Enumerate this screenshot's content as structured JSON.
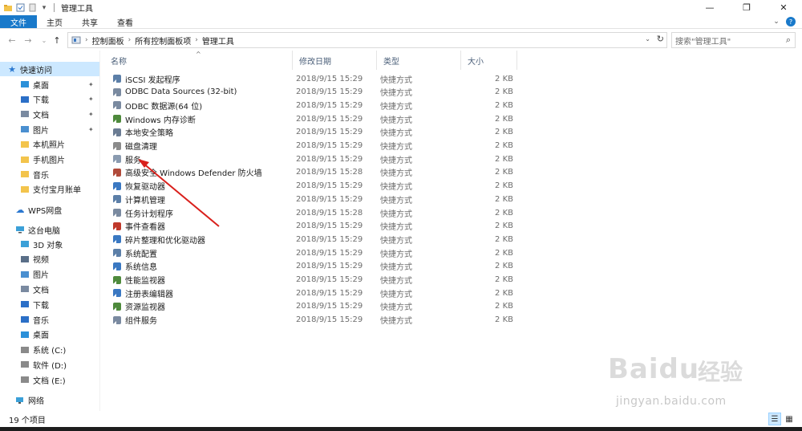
{
  "window": {
    "title": "管理工具",
    "controls": {
      "minimize": "—",
      "maximize": "❐",
      "close": "✕"
    }
  },
  "ribbon": {
    "tabs": [
      "文件",
      "主页",
      "共享",
      "查看"
    ],
    "expand_icon": "chevron-down-icon",
    "help_icon": "?"
  },
  "address": {
    "breadcrumbs": [
      "控制面板",
      "所有控制面板项",
      "管理工具"
    ],
    "search_placeholder": "搜索\"管理工具\""
  },
  "nav_pane": {
    "quick_access": "快速访问",
    "quick_items": [
      {
        "label": "桌面",
        "pinned": true,
        "icon": "desktop-icon",
        "color": "#2b90d9"
      },
      {
        "label": "下载",
        "pinned": true,
        "icon": "download-icon",
        "color": "#2b6fc7"
      },
      {
        "label": "文档",
        "pinned": true,
        "icon": "documents-icon",
        "color": "#7a8aa0"
      },
      {
        "label": "图片",
        "pinned": true,
        "icon": "pictures-icon",
        "color": "#4a8fd0"
      },
      {
        "label": "本机照片",
        "pinned": false,
        "icon": "folder-icon",
        "color": "#f3c44c"
      },
      {
        "label": "手机图片",
        "pinned": false,
        "icon": "folder-icon",
        "color": "#f3c44c"
      },
      {
        "label": "音乐",
        "pinned": false,
        "icon": "folder-icon",
        "color": "#f3c44c"
      },
      {
        "label": "支付宝月账单",
        "pinned": false,
        "icon": "folder-icon",
        "color": "#f3c44c"
      }
    ],
    "wps": "WPS网盘",
    "this_pc": "这台电脑",
    "pc_items": [
      {
        "label": "3D 对象",
        "icon": "3d-objects-icon",
        "color": "#3ba0d8"
      },
      {
        "label": "视频",
        "icon": "videos-icon",
        "color": "#5a6f88"
      },
      {
        "label": "图片",
        "icon": "pictures-icon",
        "color": "#4a8fd0"
      },
      {
        "label": "文档",
        "icon": "documents-icon",
        "color": "#7a8aa0"
      },
      {
        "label": "下载",
        "icon": "download-icon",
        "color": "#2b6fc7"
      },
      {
        "label": "音乐",
        "icon": "music-icon",
        "color": "#2b6fc7"
      },
      {
        "label": "桌面",
        "icon": "desktop-icon",
        "color": "#2b90d9"
      },
      {
        "label": "系统 (C:)",
        "icon": "drive-icon",
        "color": "#8a8a8a"
      },
      {
        "label": "软件 (D:)",
        "icon": "drive-icon",
        "color": "#8a8a8a"
      },
      {
        "label": "文档 (E:)",
        "icon": "drive-icon",
        "color": "#8a8a8a"
      }
    ],
    "network": "网络"
  },
  "columns": {
    "name": "名称",
    "date": "修改日期",
    "type": "类型",
    "size": "大小"
  },
  "files": [
    {
      "name": "iSCSI 发起程序",
      "date": "2018/9/15 15:29",
      "type": "快捷方式",
      "size": "2 KB",
      "icon": "iscsi-icon",
      "color": "#5c7fa8"
    },
    {
      "name": "ODBC Data Sources (32-bit)",
      "date": "2018/9/15 15:29",
      "type": "快捷方式",
      "size": "2 KB",
      "icon": "odbc-icon",
      "color": "#7a8aa0"
    },
    {
      "name": "ODBC 数据源(64 位)",
      "date": "2018/9/15 15:29",
      "type": "快捷方式",
      "size": "2 KB",
      "icon": "odbc-icon",
      "color": "#7a8aa0"
    },
    {
      "name": "Windows 内存诊断",
      "date": "2018/9/15 15:29",
      "type": "快捷方式",
      "size": "2 KB",
      "icon": "memory-diagnostic-icon",
      "color": "#4e8a3c"
    },
    {
      "name": "本地安全策略",
      "date": "2018/9/15 15:29",
      "type": "快捷方式",
      "size": "2 KB",
      "icon": "security-policy-icon",
      "color": "#6b7c93"
    },
    {
      "name": "磁盘清理",
      "date": "2018/9/15 15:29",
      "type": "快捷方式",
      "size": "2 KB",
      "icon": "disk-cleanup-icon",
      "color": "#8b8b8b"
    },
    {
      "name": "服务",
      "date": "2018/9/15 15:29",
      "type": "快捷方式",
      "size": "2 KB",
      "icon": "services-icon",
      "color": "#8a9bb0"
    },
    {
      "name": "高级安全 Windows Defender 防火墙",
      "date": "2018/9/15 15:28",
      "type": "快捷方式",
      "size": "2 KB",
      "icon": "firewall-icon",
      "color": "#b04a3a"
    },
    {
      "name": "恢复驱动器",
      "date": "2018/9/15 15:29",
      "type": "快捷方式",
      "size": "2 KB",
      "icon": "recovery-drive-icon",
      "color": "#3a78c2"
    },
    {
      "name": "计算机管理",
      "date": "2018/9/15 15:29",
      "type": "快捷方式",
      "size": "2 KB",
      "icon": "computer-management-icon",
      "color": "#5c7fa8"
    },
    {
      "name": "任务计划程序",
      "date": "2018/9/15 15:28",
      "type": "快捷方式",
      "size": "2 KB",
      "icon": "task-scheduler-icon",
      "color": "#7a8aa0"
    },
    {
      "name": "事件查看器",
      "date": "2018/9/15 15:29",
      "type": "快捷方式",
      "size": "2 KB",
      "icon": "event-viewer-icon",
      "color": "#c0392b"
    },
    {
      "name": "碎片整理和优化驱动器",
      "date": "2018/9/15 15:29",
      "type": "快捷方式",
      "size": "2 KB",
      "icon": "defrag-icon",
      "color": "#3a78c2"
    },
    {
      "name": "系统配置",
      "date": "2018/9/15 15:29",
      "type": "快捷方式",
      "size": "2 KB",
      "icon": "system-config-icon",
      "color": "#5c7fa8"
    },
    {
      "name": "系统信息",
      "date": "2018/9/15 15:29",
      "type": "快捷方式",
      "size": "2 KB",
      "icon": "system-info-icon",
      "color": "#3a78c2"
    },
    {
      "name": "性能监视器",
      "date": "2018/9/15 15:29",
      "type": "快捷方式",
      "size": "2 KB",
      "icon": "performance-monitor-icon",
      "color": "#4e8a3c"
    },
    {
      "name": "注册表编辑器",
      "date": "2018/9/15 15:29",
      "type": "快捷方式",
      "size": "2 KB",
      "icon": "registry-editor-icon",
      "color": "#3a78c2"
    },
    {
      "name": "资源监视器",
      "date": "2018/9/15 15:29",
      "type": "快捷方式",
      "size": "2 KB",
      "icon": "resource-monitor-icon",
      "color": "#4e8a3c"
    },
    {
      "name": "组件服务",
      "date": "2018/9/15 15:29",
      "type": "快捷方式",
      "size": "2 KB",
      "icon": "component-services-icon",
      "color": "#7a8aa0"
    }
  ],
  "status": {
    "item_count": "19 个项目"
  },
  "watermark": {
    "logo": "Baidu",
    "brand": "经验",
    "url": "jingyan.baidu.com"
  },
  "annotation_color": "#d9201c"
}
